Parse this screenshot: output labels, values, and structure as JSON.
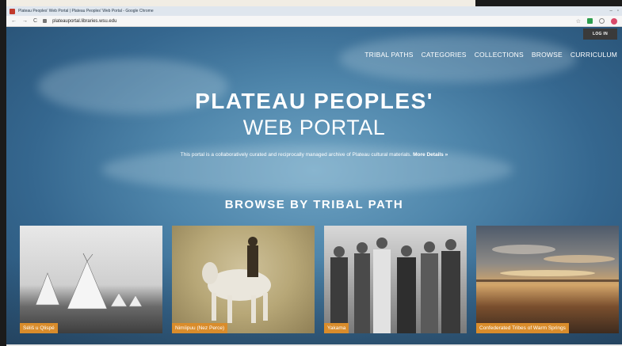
{
  "browser": {
    "window_title": "Plateau Peoples' Web Portal | Plateau Peoples' Web Portal - Google Chrome",
    "url": "plateauportal.libraries.wsu.edu"
  },
  "header": {
    "login_label": "LOG IN",
    "nav": [
      "TRIBAL PATHS",
      "CATEGORIES",
      "COLLECTIONS",
      "BROWSE",
      "CURRICULUM"
    ]
  },
  "hero": {
    "title": "PLATEAU PEOPLES'",
    "subtitle": "WEB PORTAL",
    "description": "This portal is a collaboratively curated and reciprocally managed archive of Plateau cultural materials.",
    "more_link": "More Details »"
  },
  "browse": {
    "title": "BROWSE BY TRIBAL PATH",
    "tiles": [
      "Séliš u Qlispé",
      "Nimíipuu (Nez Perce)",
      "Yakama",
      "Confederated Tribes of Warm Springs"
    ]
  }
}
